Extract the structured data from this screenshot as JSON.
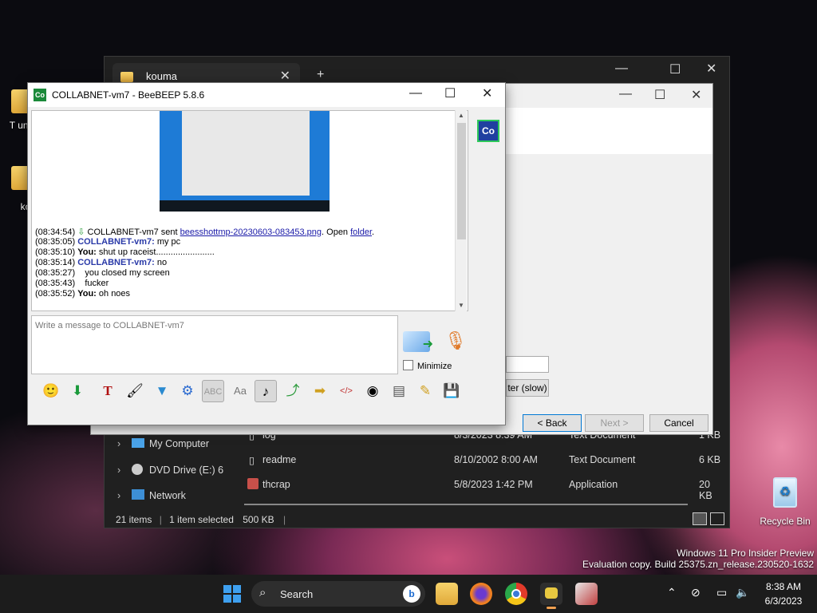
{
  "desktop": {
    "icons": [
      {
        "label": "T unpat"
      },
      {
        "label": "ko"
      }
    ],
    "recycle_bin": "Recycle Bin"
  },
  "explorer": {
    "tab_title": "kouma",
    "nav": [
      {
        "label": "My Computer"
      },
      {
        "label": "DVD Drive (E:) 6"
      },
      {
        "label": "Network"
      }
    ],
    "files": [
      {
        "name": "log",
        "date": "8/3/2023 8:39 AM",
        "type": "Text Document",
        "size": "1 KB"
      },
      {
        "name": "readme",
        "date": "8/10/2002 8:00 AM",
        "type": "Text Document",
        "size": "6 KB"
      },
      {
        "name": "thcrap",
        "date": "5/8/2023 1:42 PM",
        "type": "Application",
        "size": "20 KB"
      }
    ],
    "status": {
      "items": "21 items",
      "selected": "1 item selected",
      "size": "500 KB"
    }
  },
  "wizard": {
    "filter_btn": "ter (slow)",
    "back": "< Back",
    "next": "Next >",
    "cancel": "Cancel"
  },
  "beebeep": {
    "title": "COLLABNET-vm7 - BeeBEEP 5.8.6",
    "badge": "Co",
    "messages": [
      {
        "time": "(08:34:54)",
        "sender": "",
        "text": "COLLABNET-vm7 sent ",
        "file": "beesshottmp-20230603-083453.png",
        "suffix": ". Open ",
        "folder": "folder",
        "end": "."
      },
      {
        "time": "(08:35:05)",
        "sender": "COLLABNET-vm7:",
        "text": " my pc"
      },
      {
        "time": "(08:35:10)",
        "sender": "You:",
        "text": " shut up raceist........................"
      },
      {
        "time": "(08:35:14)",
        "sender": "COLLABNET-vm7:",
        "text": " no"
      },
      {
        "time": "(08:35:27)",
        "sender": "",
        "text": "    you closed my screen"
      },
      {
        "time": "(08:35:43)",
        "sender": "",
        "text": "    fucker"
      },
      {
        "time": "(08:35:52)",
        "sender": "You:",
        "text": " oh noes"
      }
    ],
    "placeholder": "Write a message to COLLABNET-vm7",
    "minimize": "Minimize"
  },
  "taskbar": {
    "search": "Search",
    "time": "8:38 AM",
    "date": "6/3/2023"
  },
  "watermark": {
    "line1": "Windows 11 Pro Insider Preview",
    "line2": "Evaluation copy. Build 25375.zn_release.230520-1632"
  },
  "colors": {
    "accent": "#1b8a3a",
    "link": "#1a1aa8",
    "sender": "#2a3aa8"
  }
}
